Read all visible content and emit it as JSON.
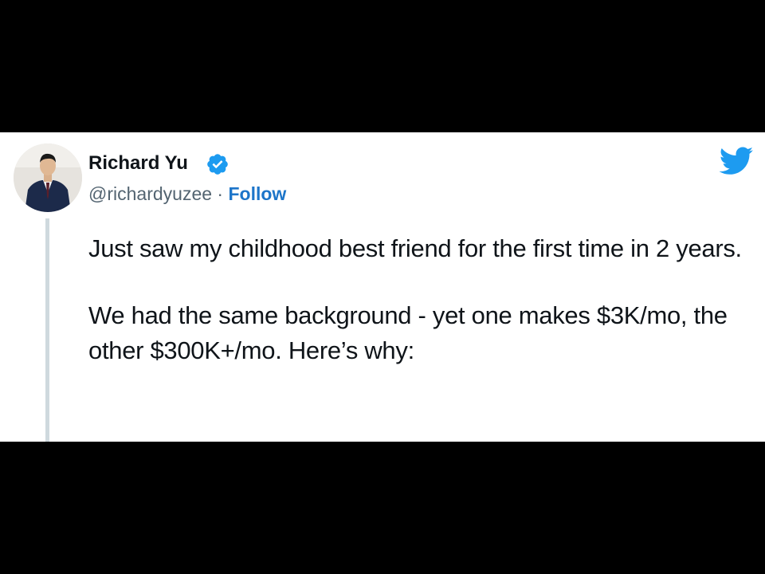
{
  "tweet": {
    "author": {
      "name": "Richard Yu",
      "handle": "@richardyuzee",
      "verified": true,
      "verified_icon": "verified-badge-icon",
      "verified_color": "#1d9bf0"
    },
    "separator": "·",
    "follow_label": "Follow",
    "follow_color": "#1d75c9",
    "brand_icon": "twitter-bird-icon",
    "brand_color": "#1d9bf0",
    "body": {
      "paragraph_1": "Just saw my childhood best friend for the first time in 2 years.",
      "paragraph_2": "We had the same background - yet one makes $3K/mo, the other $300K+/mo. Here’s why:"
    }
  }
}
